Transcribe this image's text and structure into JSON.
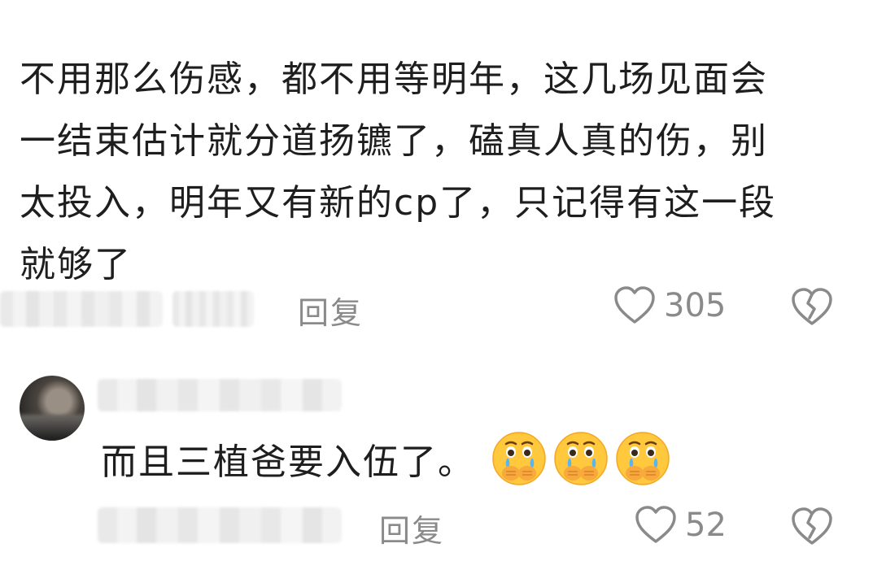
{
  "main_comment": {
    "lines": [
      "不用那么伤感，都不用等明年，这几场见面会",
      "一结束估计就分道扬镳了，磕真人真的伤，别",
      "太投入，明年又有新的cp了，只记得有这一段",
      "就够了"
    ],
    "reply_label": "回复",
    "likes": "305"
  },
  "reply_comment": {
    "text": "而且三植爸要入伍了。",
    "emojis": [
      "crying-covering-mouth-emoji",
      "crying-covering-mouth-emoji",
      "crying-covering-mouth-emoji"
    ],
    "reply_label": "回复",
    "likes": "52"
  },
  "icons": {
    "like": "heart-outline-icon",
    "dislike": "broken-heart-icon"
  },
  "colors": {
    "text": "#1e1e1e",
    "muted": "#8a8a8a",
    "emoji_face": "#ffc83d"
  }
}
